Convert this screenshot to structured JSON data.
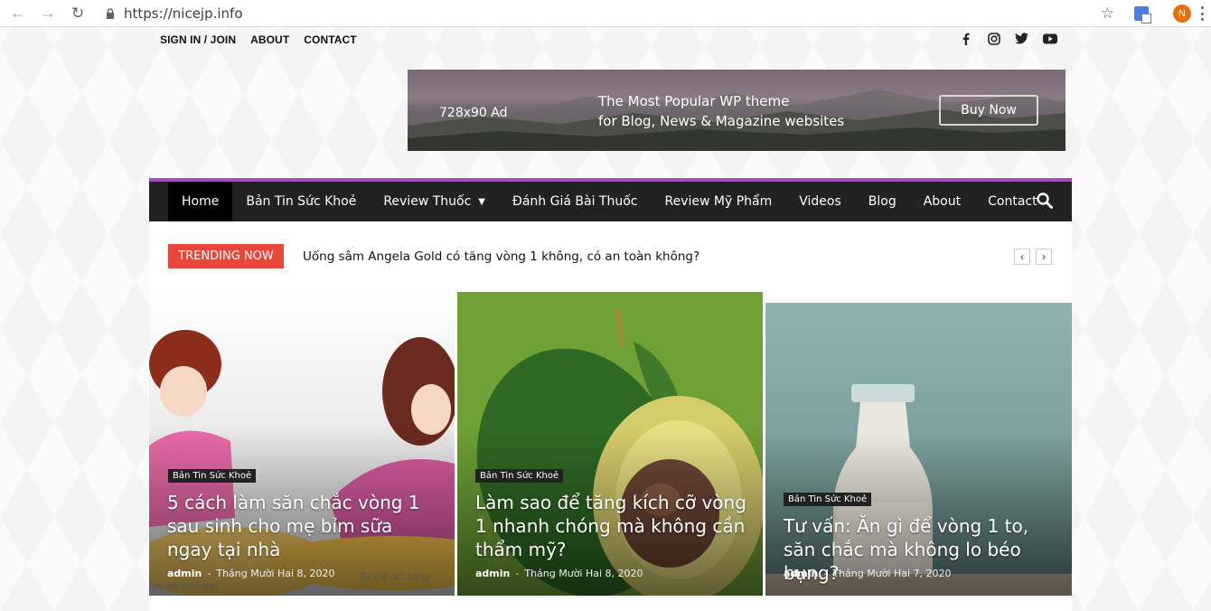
{
  "browser": {
    "url": "https://nicejp.info",
    "avatar_letter": "N"
  },
  "top_menu": [
    {
      "label": "SIGN IN / JOIN"
    },
    {
      "label": "ABOUT"
    },
    {
      "label": "CONTACT"
    }
  ],
  "socials": [
    "facebook-icon",
    "instagram-icon",
    "twitter-icon",
    "youtube-icon"
  ],
  "ad": {
    "size_label": "728x90 Ad",
    "line1": "The Most Popular WP theme",
    "line2": "for Blog, News & Magazine websites",
    "button": "Buy Now"
  },
  "nav": {
    "items": [
      {
        "label": "Home"
      },
      {
        "label": "Bản Tin Sức Khoẻ"
      },
      {
        "label": "Review Thuốc"
      },
      {
        "label": "Đánh Giá Bài Thuốc"
      },
      {
        "label": "Review Mỹ Phẩm"
      },
      {
        "label": "Videos"
      },
      {
        "label": "Blog"
      },
      {
        "label": "About"
      },
      {
        "label": "Contact"
      }
    ],
    "accent": "#9e4fb8"
  },
  "trending": {
    "label": "TRENDING NOW",
    "headline": "Uống sâm Angela Gold có tăng vòng 1 không, có an toàn không?"
  },
  "cards": [
    {
      "category": "Bản Tin Sức Khoẻ",
      "title": "5 cách làm săn chắc vòng 1 sau sinh cho mẹ bỉm sữa ngay tại nhà",
      "author": "admin",
      "date": "Tháng Mười Hai 8, 2020",
      "image_caption_1": "Tư thế ôm bóng",
      "image_caption_2": "ôm trẻ vừi cánh"
    },
    {
      "category": "Bản Tin Sức Khoẻ",
      "title": "Làm sao để tăng kích cỡ vòng 1 nhanh chóng mà không cần thẩm mỹ?",
      "author": "admin",
      "date": "Tháng Mười Hai 8, 2020"
    },
    {
      "category": "Bản Tin Sức Khoẻ",
      "title": "Tư vấn: Ăn gì để vòng 1 to, săn chắc mà không lo béo bụng?",
      "author": "admin",
      "date": "Tháng Mười Hai 7, 2020"
    }
  ],
  "colors": {
    "trending_red": "#e9463a",
    "nav_bg": "#222222"
  }
}
